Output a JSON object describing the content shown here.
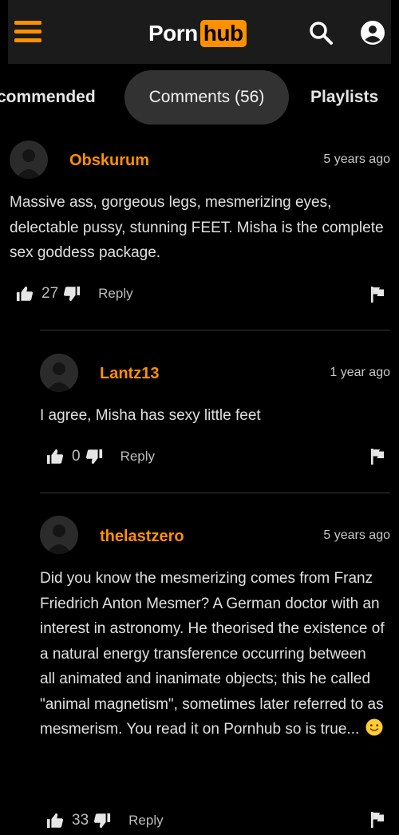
{
  "header": {
    "logo_left": "Porn",
    "logo_right": "hub",
    "accent_color": "#ff9000",
    "icons": [
      "menu-icon",
      "search-icon",
      "user-icon"
    ]
  },
  "tabs": [
    {
      "label": "commended",
      "active": false
    },
    {
      "label": "Comments (56)",
      "active": true
    },
    {
      "label": "Playlists",
      "active": false
    }
  ],
  "comments": [
    {
      "username": "Obskurum",
      "time": "5 years ago",
      "text": "Massive ass, gorgeous legs, mesmerizing eyes, delectable pussy, stunning FEET. Misha is the complete sex goddess package.",
      "votes": "27",
      "reply_label": "Reply"
    },
    {
      "username": "Lantz13",
      "time": "1 year ago",
      "text": "I agree, Misha has sexy little feet",
      "votes": "0",
      "reply_label": "Reply"
    },
    {
      "username": "thelastzero",
      "time": "5 years ago",
      "text": "Did you know the mesmerizing comes from Franz Friedrich Anton Mesmer? A German doctor with an interest in astronomy. He theorised the existence of a natural energy transference occurring between all animated and inanimate objects; this he called \"animal magnetism\", sometimes later referred to as mesmerism. You read it on Pornhub so is true...",
      "emoji": "slightly-smiling-face",
      "votes": "33",
      "reply_label": "Reply"
    }
  ]
}
